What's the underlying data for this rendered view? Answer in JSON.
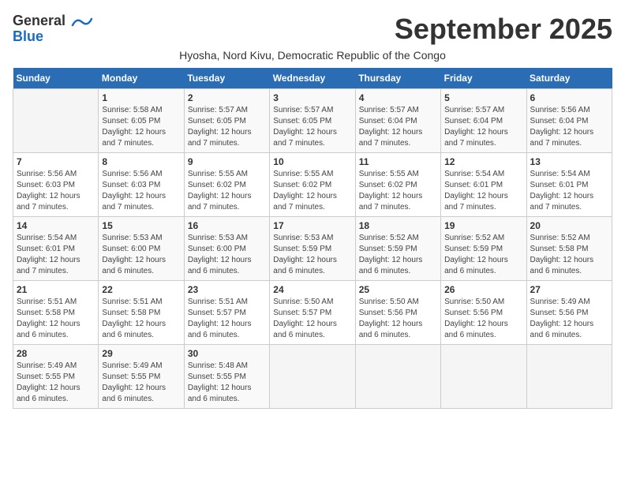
{
  "header": {
    "logo_general": "General",
    "logo_blue": "Blue",
    "month_title": "September 2025",
    "subtitle": "Hyosha, Nord Kivu, Democratic Republic of the Congo"
  },
  "days_of_week": [
    "Sunday",
    "Monday",
    "Tuesday",
    "Wednesday",
    "Thursday",
    "Friday",
    "Saturday"
  ],
  "weeks": [
    [
      {
        "day": "",
        "info": ""
      },
      {
        "day": "1",
        "info": "Sunrise: 5:58 AM\nSunset: 6:05 PM\nDaylight: 12 hours\nand 7 minutes."
      },
      {
        "day": "2",
        "info": "Sunrise: 5:57 AM\nSunset: 6:05 PM\nDaylight: 12 hours\nand 7 minutes."
      },
      {
        "day": "3",
        "info": "Sunrise: 5:57 AM\nSunset: 6:05 PM\nDaylight: 12 hours\nand 7 minutes."
      },
      {
        "day": "4",
        "info": "Sunrise: 5:57 AM\nSunset: 6:04 PM\nDaylight: 12 hours\nand 7 minutes."
      },
      {
        "day": "5",
        "info": "Sunrise: 5:57 AM\nSunset: 6:04 PM\nDaylight: 12 hours\nand 7 minutes."
      },
      {
        "day": "6",
        "info": "Sunrise: 5:56 AM\nSunset: 6:04 PM\nDaylight: 12 hours\nand 7 minutes."
      }
    ],
    [
      {
        "day": "7",
        "info": "Sunrise: 5:56 AM\nSunset: 6:03 PM\nDaylight: 12 hours\nand 7 minutes."
      },
      {
        "day": "8",
        "info": "Sunrise: 5:56 AM\nSunset: 6:03 PM\nDaylight: 12 hours\nand 7 minutes."
      },
      {
        "day": "9",
        "info": "Sunrise: 5:55 AM\nSunset: 6:02 PM\nDaylight: 12 hours\nand 7 minutes."
      },
      {
        "day": "10",
        "info": "Sunrise: 5:55 AM\nSunset: 6:02 PM\nDaylight: 12 hours\nand 7 minutes."
      },
      {
        "day": "11",
        "info": "Sunrise: 5:55 AM\nSunset: 6:02 PM\nDaylight: 12 hours\nand 7 minutes."
      },
      {
        "day": "12",
        "info": "Sunrise: 5:54 AM\nSunset: 6:01 PM\nDaylight: 12 hours\nand 7 minutes."
      },
      {
        "day": "13",
        "info": "Sunrise: 5:54 AM\nSunset: 6:01 PM\nDaylight: 12 hours\nand 7 minutes."
      }
    ],
    [
      {
        "day": "14",
        "info": "Sunrise: 5:54 AM\nSunset: 6:01 PM\nDaylight: 12 hours\nand 7 minutes."
      },
      {
        "day": "15",
        "info": "Sunrise: 5:53 AM\nSunset: 6:00 PM\nDaylight: 12 hours\nand 6 minutes."
      },
      {
        "day": "16",
        "info": "Sunrise: 5:53 AM\nSunset: 6:00 PM\nDaylight: 12 hours\nand 6 minutes."
      },
      {
        "day": "17",
        "info": "Sunrise: 5:53 AM\nSunset: 5:59 PM\nDaylight: 12 hours\nand 6 minutes."
      },
      {
        "day": "18",
        "info": "Sunrise: 5:52 AM\nSunset: 5:59 PM\nDaylight: 12 hours\nand 6 minutes."
      },
      {
        "day": "19",
        "info": "Sunrise: 5:52 AM\nSunset: 5:59 PM\nDaylight: 12 hours\nand 6 minutes."
      },
      {
        "day": "20",
        "info": "Sunrise: 5:52 AM\nSunset: 5:58 PM\nDaylight: 12 hours\nand 6 minutes."
      }
    ],
    [
      {
        "day": "21",
        "info": "Sunrise: 5:51 AM\nSunset: 5:58 PM\nDaylight: 12 hours\nand 6 minutes."
      },
      {
        "day": "22",
        "info": "Sunrise: 5:51 AM\nSunset: 5:58 PM\nDaylight: 12 hours\nand 6 minutes."
      },
      {
        "day": "23",
        "info": "Sunrise: 5:51 AM\nSunset: 5:57 PM\nDaylight: 12 hours\nand 6 minutes."
      },
      {
        "day": "24",
        "info": "Sunrise: 5:50 AM\nSunset: 5:57 PM\nDaylight: 12 hours\nand 6 minutes."
      },
      {
        "day": "25",
        "info": "Sunrise: 5:50 AM\nSunset: 5:56 PM\nDaylight: 12 hours\nand 6 minutes."
      },
      {
        "day": "26",
        "info": "Sunrise: 5:50 AM\nSunset: 5:56 PM\nDaylight: 12 hours\nand 6 minutes."
      },
      {
        "day": "27",
        "info": "Sunrise: 5:49 AM\nSunset: 5:56 PM\nDaylight: 12 hours\nand 6 minutes."
      }
    ],
    [
      {
        "day": "28",
        "info": "Sunrise: 5:49 AM\nSunset: 5:55 PM\nDaylight: 12 hours\nand 6 minutes."
      },
      {
        "day": "29",
        "info": "Sunrise: 5:49 AM\nSunset: 5:55 PM\nDaylight: 12 hours\nand 6 minutes."
      },
      {
        "day": "30",
        "info": "Sunrise: 5:48 AM\nSunset: 5:55 PM\nDaylight: 12 hours\nand 6 minutes."
      },
      {
        "day": "",
        "info": ""
      },
      {
        "day": "",
        "info": ""
      },
      {
        "day": "",
        "info": ""
      },
      {
        "day": "",
        "info": ""
      }
    ]
  ]
}
